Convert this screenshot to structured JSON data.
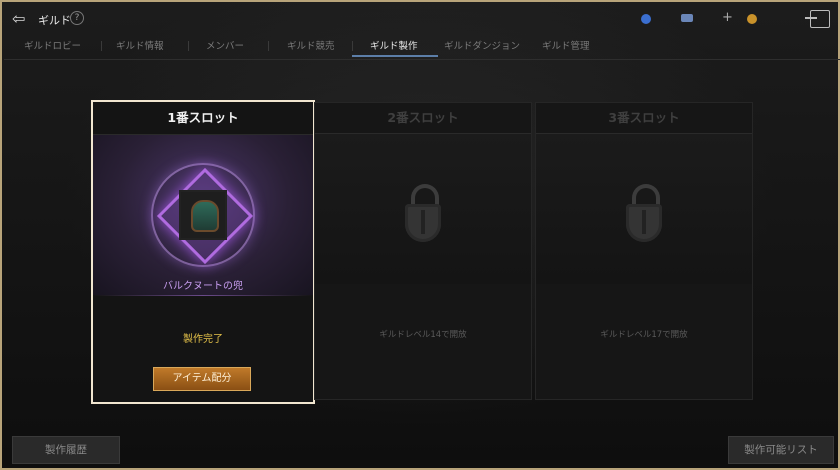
{
  "header": {
    "title": "ギルド",
    "help": "?",
    "plus": "+"
  },
  "tabs": [
    {
      "label": "ギルドロビー"
    },
    {
      "label": "ギルド情報"
    },
    {
      "label": "メンバー"
    },
    {
      "label": "ギルド競売"
    },
    {
      "label": "ギルド製作"
    },
    {
      "label": "ギルドダンジョン"
    },
    {
      "label": "ギルド管理"
    }
  ],
  "slots": [
    {
      "title": "1番スロット",
      "item_name": "バルクヌートの兜",
      "status": "製作完了",
      "button": "アイテム配分"
    },
    {
      "title": "2番スロット",
      "requirement": "ギルドレベル14で開放"
    },
    {
      "title": "3番スロット",
      "requirement": "ギルドレベル17で開放"
    }
  ],
  "footer": {
    "history_button": "製作履歴",
    "list_button": "製作可能リスト"
  },
  "colors": {
    "frame": "#b8a47a",
    "active_tab_underline": "#5c7ea8",
    "item_name": "#c89df0",
    "status": "#e6c34a",
    "accent_button": "#c07a2a"
  }
}
